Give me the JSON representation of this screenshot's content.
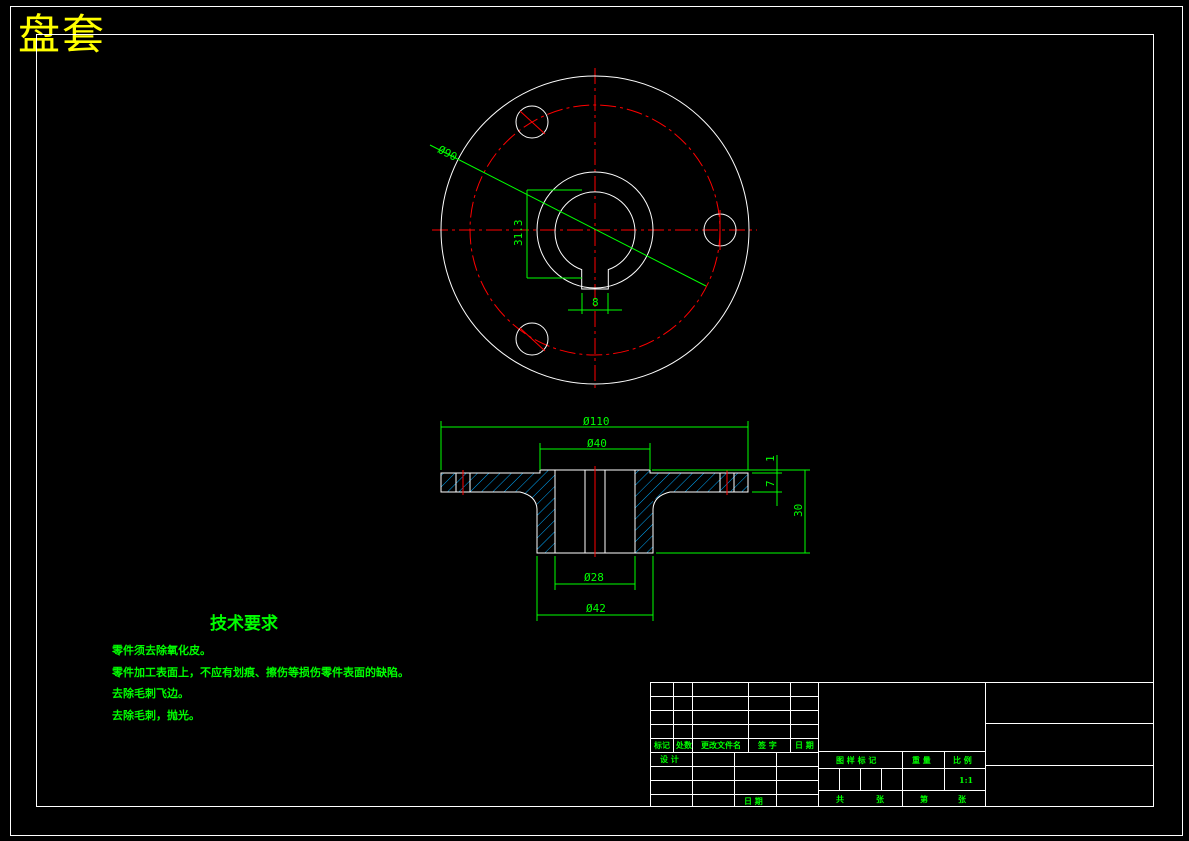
{
  "drawing": {
    "title": "盘套",
    "dimensions": {
      "bolt_circle": "Ø90",
      "bore_keyway_height": "31.3",
      "keyway_width": "8",
      "outer_diameter": "Ø110",
      "hub_top_diameter": "Ø40",
      "flange_step": "1",
      "flange_thickness": "7",
      "total_height": "30",
      "bore_diameter": "Ø28",
      "hub_diameter": "Ø42"
    },
    "technical_requirements": {
      "heading": "技术要求",
      "items": [
        "零件须去除氧化皮。",
        "零件加工表面上，不应有划痕、擦伤等损伤零件表面的缺陷。",
        "去除毛刺飞边。",
        "去除毛刺，抛光。"
      ]
    },
    "title_block": {
      "rev_headers": [
        "标记",
        "处数",
        "更改文件名",
        "签 字",
        "日 期"
      ],
      "design": "设 计",
      "date_label": "日 期",
      "info_headers": [
        "图 样 标 记",
        "重 量",
        "比 例"
      ],
      "scale": "1:1",
      "sheet_labels": [
        "共",
        "张",
        "第",
        "张"
      ]
    },
    "colors": {
      "outline": "#ffffff",
      "centerline": "#ff0000",
      "dimension": "#00ff00",
      "title_text": "#ffff00",
      "hatch": "#00aaff"
    }
  }
}
